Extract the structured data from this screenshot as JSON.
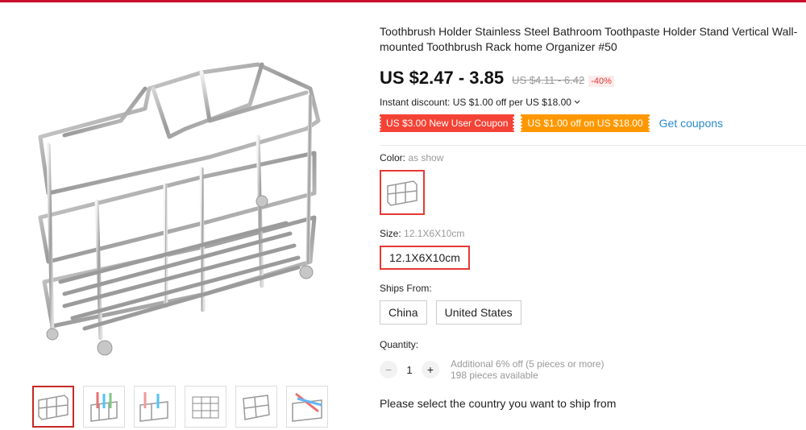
{
  "product": {
    "title": "Toothbrush Holder Stainless Steel Bathroom Toothpaste Holder Stand Vertical Wall-mounted Toothbrush Rack home Organizer #50",
    "price": "US $2.47 - 3.85",
    "original_price": "US $4.11 - 6.42",
    "discount": "-40%",
    "instant_discount": "Instant discount: US $1.00 off per US $18.00",
    "coupons": [
      "US $3.00 New User Coupon",
      "US $1.00 off on US $18.00"
    ],
    "get_coupons": "Get coupons"
  },
  "color": {
    "label": "Color:",
    "value": "as show"
  },
  "size": {
    "label": "Size:",
    "value": "12.1X6X10cm",
    "options": [
      "12.1X6X10cm"
    ]
  },
  "ships_from": {
    "label": "Ships From:",
    "options": [
      "China",
      "United States"
    ]
  },
  "quantity": {
    "label": "Quantity:",
    "value": "1",
    "minus": "−",
    "plus": "+",
    "additional": "Additional 6% off (5 pieces or more)",
    "available": "198 pieces available"
  },
  "ship_country_prompt": "Please select the country you want to ship from",
  "colors": {
    "accent": "#e53935",
    "link": "#2a8acb",
    "coupon_red": "#f44336",
    "coupon_orange": "#ff9800"
  }
}
